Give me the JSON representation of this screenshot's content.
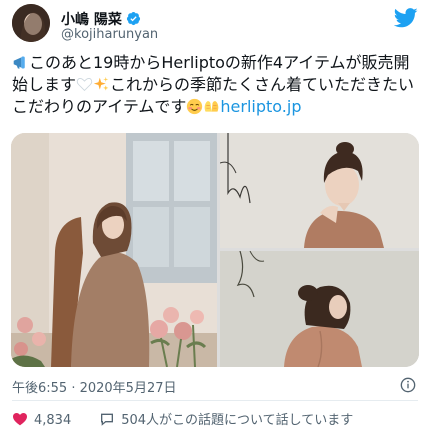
{
  "user": {
    "display_name": "小嶋 陽菜",
    "handle": "@kojiharunyan",
    "verified": true
  },
  "tweet": {
    "text_part1": "このあと19時からHerliptoの新作4アイテムが販売開始します",
    "text_part2": "これからの季節たくさん着ていただきたいこだわりのアイテムです",
    "link": "herlipto.jp",
    "emojis": [
      "megaphone-icon",
      "white-heart-icon",
      "sparkles-icon",
      "smiling-face-icon",
      "hands-icon"
    ],
    "timestamp": "午後6:55 · 2020年5月27日"
  },
  "media": {
    "count": 3,
    "layout": "1 tall left, 2 stacked right"
  },
  "actions": {
    "like_count": "4,834",
    "reply_text": "504人がこの話題について話しています"
  },
  "colors": {
    "twitter_blue": "#1DA1F2",
    "link": "#1b95e0",
    "like_red": "#e0245e",
    "secondary_text": "#536471"
  }
}
